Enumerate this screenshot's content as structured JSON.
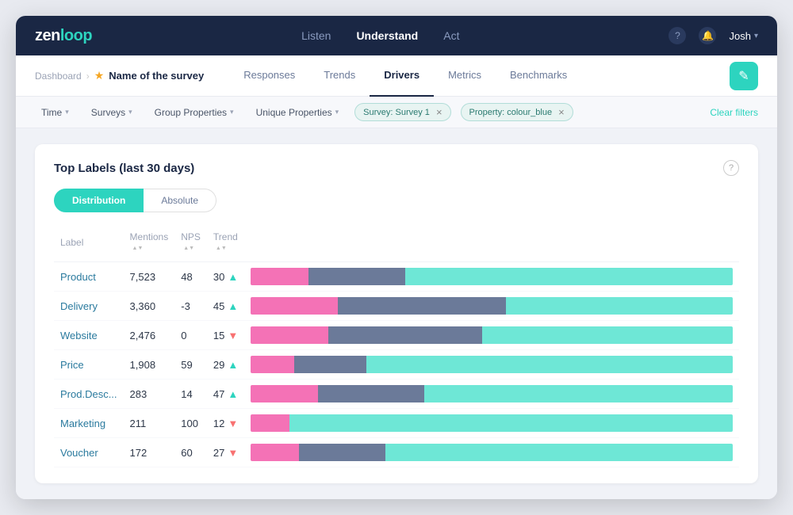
{
  "app": {
    "logo_text": "zenloop"
  },
  "nav": {
    "links": [
      {
        "label": "Listen",
        "active": false
      },
      {
        "label": "Understand",
        "active": true
      },
      {
        "label": "Act",
        "active": false
      }
    ],
    "user": "Josh",
    "help_icon": "?",
    "bell_icon": "🔔"
  },
  "breadcrumb": {
    "dashboard": "Dashboard",
    "arrow": "›",
    "star": "★",
    "survey_name": "Name of the survey"
  },
  "tabs": [
    {
      "label": "Responses",
      "active": false
    },
    {
      "label": "Trends",
      "active": false
    },
    {
      "label": "Drivers",
      "active": true
    },
    {
      "label": "Metrics",
      "active": false
    },
    {
      "label": "Benchmarks",
      "active": false
    }
  ],
  "edit_button_icon": "✎",
  "filters": {
    "time_label": "Time",
    "surveys_label": "Surveys",
    "group_props_label": "Group Properties",
    "unique_props_label": "Unique Properties",
    "active_tags": [
      {
        "text": "Survey: Survey 1"
      },
      {
        "text": "Property: colour_blue"
      }
    ],
    "clear_label": "Clear filters"
  },
  "card": {
    "title": "Top Labels (last 30 days)",
    "toggle": {
      "distribution": "Distribution",
      "absolute": "Absolute"
    },
    "table": {
      "headers": [
        {
          "key": "label",
          "text": "Label",
          "sortable": false
        },
        {
          "key": "mentions",
          "text": "Mentions",
          "sortable": true
        },
        {
          "key": "nps",
          "text": "NPS",
          "sortable": true
        },
        {
          "key": "trend",
          "text": "Trend",
          "sortable": true
        }
      ],
      "rows": [
        {
          "label": "Product",
          "mentions": "7,523",
          "nps": "48",
          "trend": "30",
          "trend_dir": "up",
          "bar": {
            "pink": 12,
            "gray": 20,
            "teal": 68
          }
        },
        {
          "label": "Delivery",
          "mentions": "3,360",
          "nps": "-3",
          "trend": "45",
          "trend_dir": "up",
          "bar": {
            "pink": 18,
            "gray": 35,
            "teal": 47
          }
        },
        {
          "label": "Website",
          "mentions": "2,476",
          "nps": "0",
          "trend": "15",
          "trend_dir": "down",
          "bar": {
            "pink": 16,
            "gray": 32,
            "teal": 52
          }
        },
        {
          "label": "Price",
          "mentions": "1,908",
          "nps": "59",
          "trend": "29",
          "trend_dir": "up",
          "bar": {
            "pink": 9,
            "gray": 15,
            "teal": 76
          }
        },
        {
          "label": "Prod.Desc...",
          "mentions": "283",
          "nps": "14",
          "trend": "47",
          "trend_dir": "up",
          "bar": {
            "pink": 14,
            "gray": 22,
            "teal": 64
          }
        },
        {
          "label": "Marketing",
          "mentions": "211",
          "nps": "100",
          "trend": "12",
          "trend_dir": "down",
          "bar": {
            "pink": 8,
            "gray": 0,
            "teal": 92
          }
        },
        {
          "label": "Voucher",
          "mentions": "172",
          "nps": "60",
          "trend": "27",
          "trend_dir": "down",
          "bar": {
            "pink": 10,
            "gray": 18,
            "teal": 72
          }
        }
      ]
    }
  }
}
